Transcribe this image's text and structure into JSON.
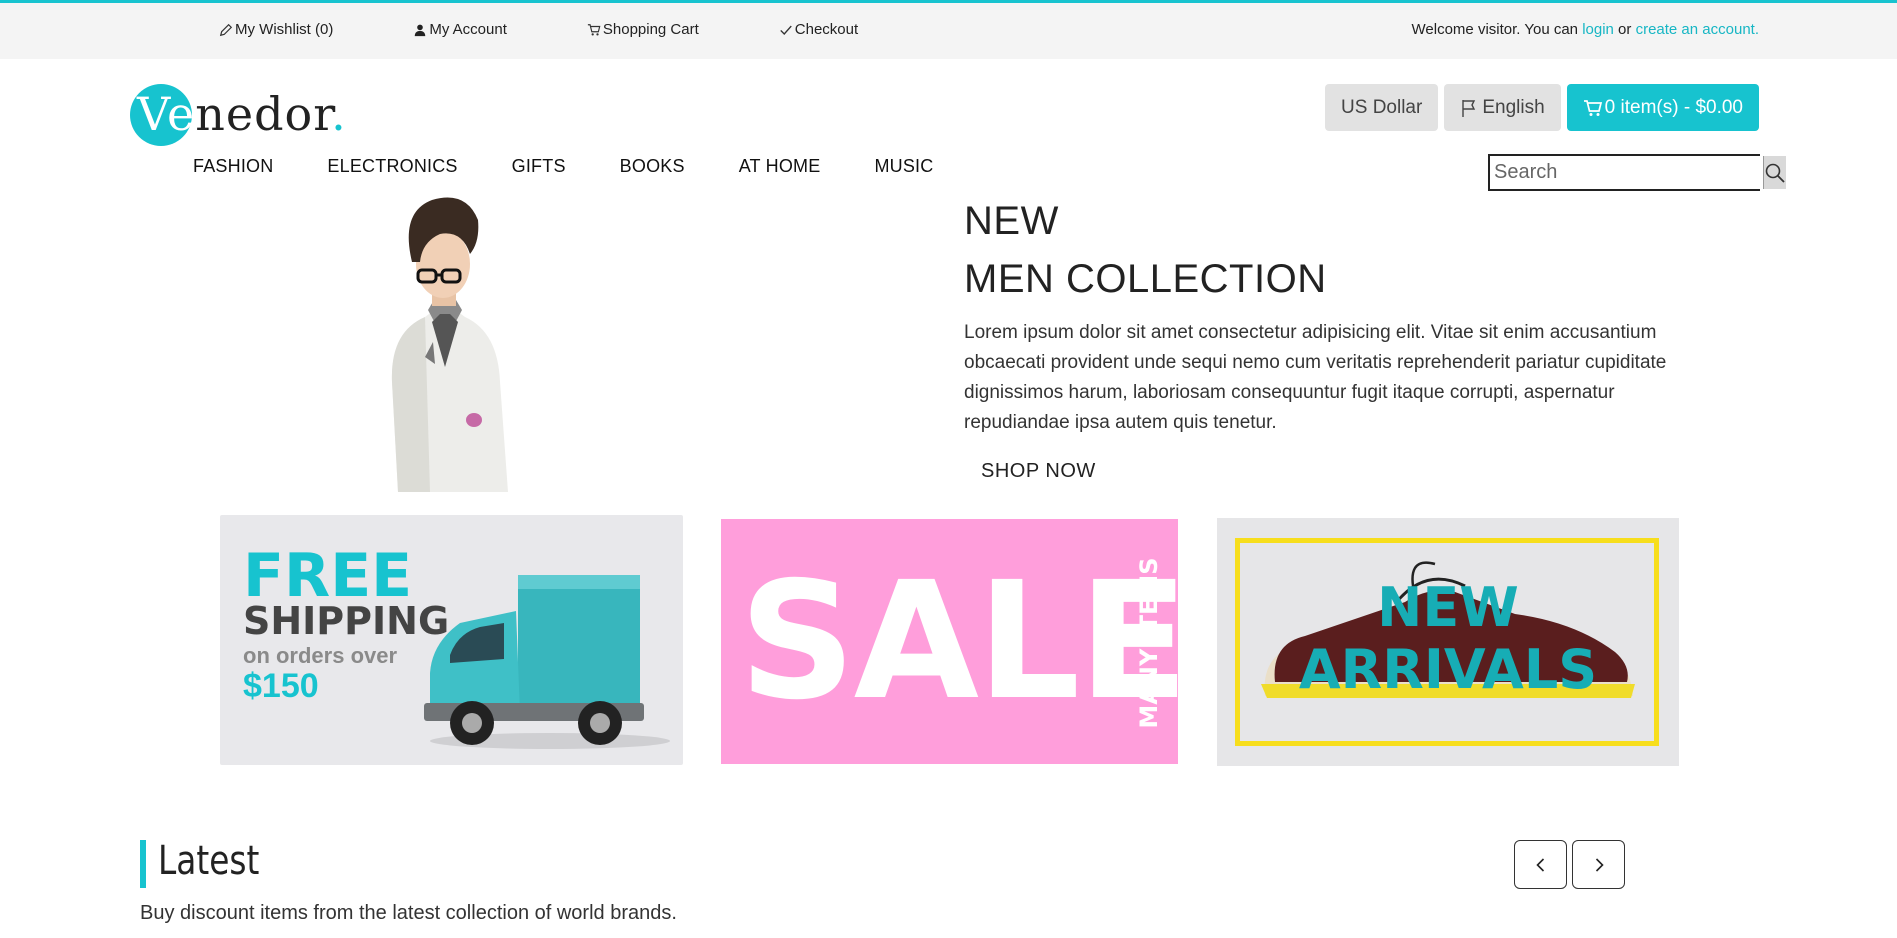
{
  "topbar": {
    "links": {
      "wishlist": "My Wishlist (0)",
      "account": "My Account",
      "cart": "Shopping Cart",
      "checkout": "Checkout"
    },
    "welcome_prefix": "Welcome visitor. You can ",
    "login": "login",
    "or": " or ",
    "create_account": "create an account."
  },
  "logo": {
    "ve": "Ve",
    "rest": "nedor",
    "dot": "."
  },
  "header": {
    "currency": "US Dollar",
    "language": "English",
    "cart": "0 item(s) - $0.00"
  },
  "nav": [
    "FASHION",
    "ELECTRONICS",
    "GIFTS",
    "BOOKS",
    "AT HOME",
    "MUSIC"
  ],
  "search": {
    "placeholder": "Search"
  },
  "hero": {
    "line1": "NEW",
    "line2": "MEN COLLECTION",
    "body": "Lorem ipsum dolor sit amet consectetur adipisicing elit. Vitae sit enim accusantium obcaecati provident unde sequi nemo cum veritatis reprehenderit pariatur cupiditate dignissimos harum, laboriosam consequuntur fugit itaque corrupti, aspernatur repudiandae ipsa autem quis tenetur.",
    "cta": "SHOP NOW"
  },
  "banners": {
    "shipping": {
      "free": "FREE",
      "shipping": "SHIPPING",
      "orders": "on orders over",
      "amount": "$150"
    },
    "sale": {
      "sale": "SALE",
      "many": "MANY ITEMS"
    },
    "arrivals": {
      "line1": "NEW",
      "line2": "ARRIVALS"
    }
  },
  "latest": {
    "title": "Latest",
    "subtitle": "Buy discount items from the latest collection of world brands."
  },
  "colors": {
    "accent": "#17c3cf",
    "sale_bg": "#ff9edb",
    "frame": "#f7de1c"
  }
}
